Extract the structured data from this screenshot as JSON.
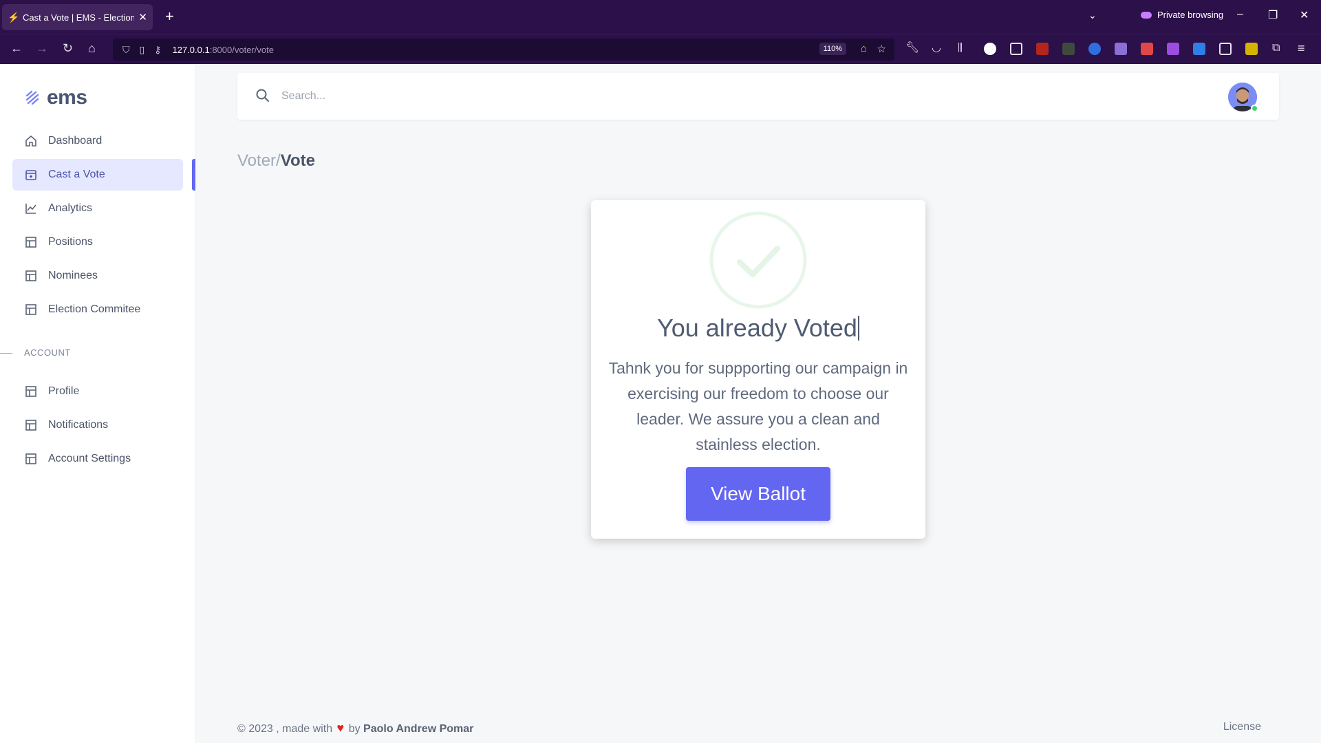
{
  "browser": {
    "tab_title": "Cast a Vote | EMS - Election Ma",
    "private_label": "Private browsing",
    "url_host": "127.0.0.1",
    "url_path": ":8000/voter/vote",
    "zoom": "110%"
  },
  "app": {
    "logo": "ems",
    "accent_color": "#6366f1"
  },
  "sidebar": {
    "items": [
      {
        "label": "Dashboard",
        "icon": "home-icon"
      },
      {
        "label": "Cast a Vote",
        "icon": "ballot-icon",
        "active": true
      },
      {
        "label": "Analytics",
        "icon": "chart-icon"
      },
      {
        "label": "Positions",
        "icon": "layout-icon"
      },
      {
        "label": "Nominees",
        "icon": "layout-icon"
      },
      {
        "label": "Election Commitee",
        "icon": "layout-icon"
      }
    ],
    "account_label": "ACCOUNT",
    "account_items": [
      {
        "label": "Profile",
        "icon": "layout-icon"
      },
      {
        "label": "Notifications",
        "icon": "layout-icon"
      },
      {
        "label": "Account Settings",
        "icon": "layout-icon"
      }
    ]
  },
  "search": {
    "placeholder": "Search..."
  },
  "breadcrumb": {
    "parent": "Voter/",
    "current": "Vote"
  },
  "card": {
    "title": "You already Voted",
    "message": "Tahnk you for suppporting our campaign in exercising our freedom to choose our leader. We assure you a clean and stainless election.",
    "button_label": "View Ballot"
  },
  "footer": {
    "prefix": "© 2023 , made with",
    "by": "by",
    "author": "Paolo Andrew Pomar",
    "license": "License"
  }
}
